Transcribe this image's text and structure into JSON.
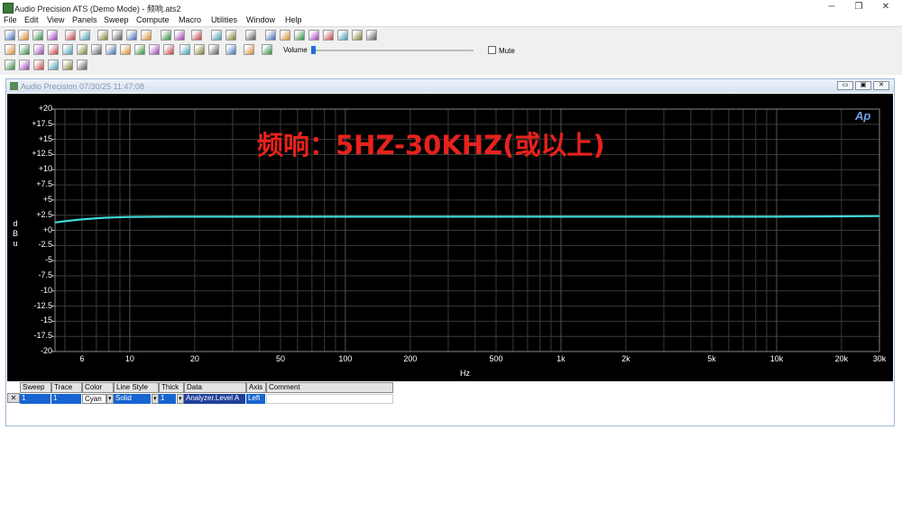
{
  "app": {
    "title": "Audio Precision ATS (Demo Mode) - 频响.ats2",
    "minimize_glyph": "─",
    "restore_glyph": "❐",
    "close_glyph": "✕"
  },
  "menu": [
    "File",
    "Edit",
    "View",
    "Panels",
    "Sweep",
    "Compute",
    "Macro",
    "Utilities",
    "Window",
    "Help"
  ],
  "toolbar": {
    "volume_label": "Volume",
    "mute_label": "Mute",
    "volume_level": 0.0
  },
  "graph_window": {
    "title": "Audio Precision  07/30/25 11:47:08",
    "annotation": "频响：5HZ-30KHZ(或以上)",
    "logo": "Ap",
    "ylabel_letters": [
      "d",
      "B",
      "u"
    ],
    "xlabel": "Hz",
    "win_min": "▭",
    "win_max": "▣",
    "win_close": "✕"
  },
  "chart_data": {
    "type": "line",
    "x_scale": "log",
    "xlim": [
      4.5,
      30000
    ],
    "ylim": [
      -20,
      20
    ],
    "grid": true,
    "xlabel": "Hz",
    "ylabel": "dBu",
    "y_ticks": [
      "+20",
      "+17.5",
      "+15",
      "+12.5",
      "+10",
      "+7.5",
      "+5",
      "+2.5",
      "+0",
      "-2.5",
      "-5",
      "-7.5",
      "-10",
      "-12.5",
      "-15",
      "-17.5",
      "-20"
    ],
    "x_ticks": [
      {
        "v": 6,
        "label": "6"
      },
      {
        "v": 10,
        "label": "10"
      },
      {
        "v": 20,
        "label": "20"
      },
      {
        "v": 50,
        "label": "50"
      },
      {
        "v": 100,
        "label": "100"
      },
      {
        "v": 200,
        "label": "200"
      },
      {
        "v": 500,
        "label": "500"
      },
      {
        "v": 1000,
        "label": "1k"
      },
      {
        "v": 2000,
        "label": "2k"
      },
      {
        "v": 5000,
        "label": "5k"
      },
      {
        "v": 10000,
        "label": "10k"
      },
      {
        "v": 20000,
        "label": "20k"
      },
      {
        "v": 30000,
        "label": "30k"
      }
    ],
    "series": [
      {
        "color": "#3fd6d6",
        "x": [
          4.5,
          5,
          6,
          7,
          8,
          10,
          15,
          20,
          50,
          100,
          500,
          1000,
          5000,
          10000,
          20000,
          30000
        ],
        "y": [
          1.3,
          1.5,
          1.8,
          2.0,
          2.1,
          2.2,
          2.25,
          2.25,
          2.25,
          2.25,
          2.25,
          2.25,
          2.25,
          2.25,
          2.3,
          2.35
        ]
      }
    ]
  },
  "legend": {
    "headers": [
      "Sweep",
      "Trace",
      "Color",
      "Line Style",
      "Thick",
      "Data",
      "Axis",
      "Comment"
    ],
    "row": [
      "1",
      "1",
      "Cyan",
      "Solid",
      "1",
      "Analyzer.Level A",
      "Left",
      ""
    ]
  }
}
